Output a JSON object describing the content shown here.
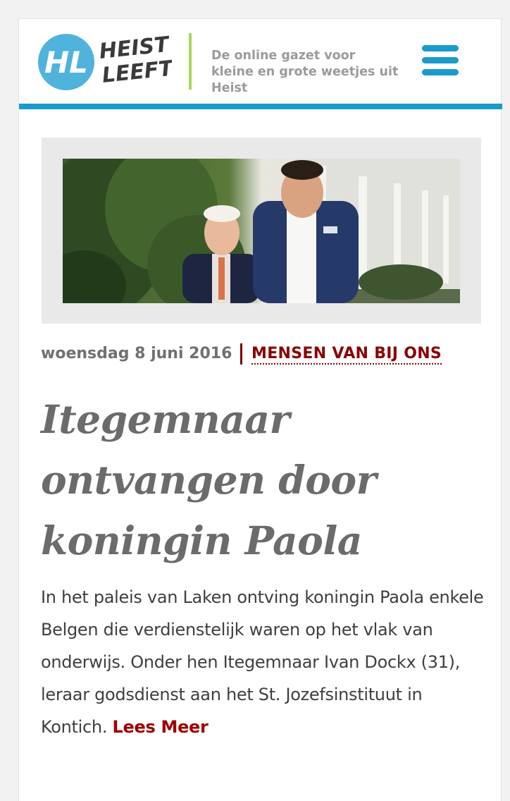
{
  "header": {
    "logo_text_line1": "HEIST",
    "logo_text_line2": "LEEFT",
    "logo_monogram": "HL",
    "tagline": "De online gazet voor kleine en grote weetjes uit Heist",
    "menu_icon": "hamburger-menu-icon"
  },
  "colors": {
    "brand_blue": "#1a9bcb",
    "accent_green": "#a8d65b",
    "link_red": "#a00000",
    "category_red": "#8b0000",
    "title_gray": "#6b6b6b"
  },
  "article": {
    "date": "woensdag 8 juni 2016",
    "category": "MENSEN VAN BIJ ONS",
    "title": "Itegemnaar ontvangen door koningin Paola",
    "excerpt": "In het paleis van Laken ontving koningin Paola enkele Belgen die verdienstelijk waren op het vlak van onderwijs. Onder hen Itegemnaar Ivan Dockx (31), leraar godsdienst aan het St. Jozefsinstituut in Kontich.",
    "read_more": "Lees Meer"
  }
}
